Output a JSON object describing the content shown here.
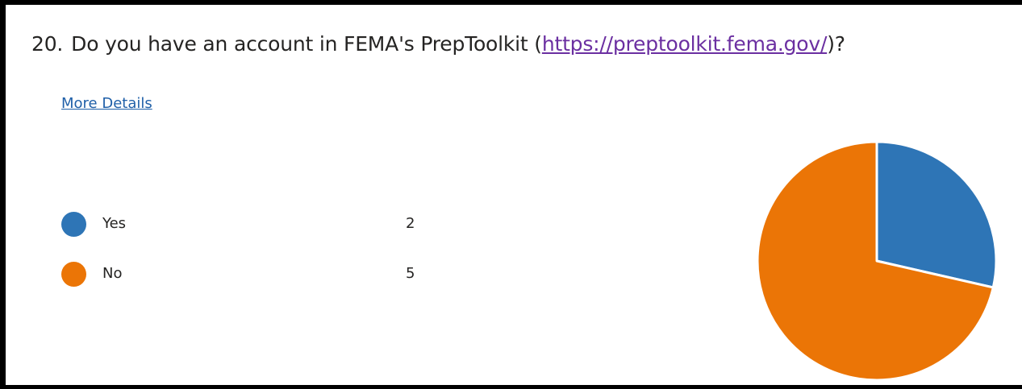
{
  "question": {
    "number": "20.",
    "text_before": "Do you have an account in FEMA's PrepToolkit (",
    "link": "https://preptoolkit.fema.gov/",
    "text_after": ")?"
  },
  "more_details": "More Details",
  "colors": {
    "yes": "#2e75b6",
    "no": "#eb7506"
  },
  "chart_data": {
    "type": "pie",
    "categories": [
      "Yes",
      "No"
    ],
    "values": [
      2,
      5
    ],
    "colors": [
      "#2e75b6",
      "#eb7506"
    ]
  },
  "legend": [
    {
      "label": "Yes",
      "value": "2"
    },
    {
      "label": "No",
      "value": "5"
    }
  ]
}
